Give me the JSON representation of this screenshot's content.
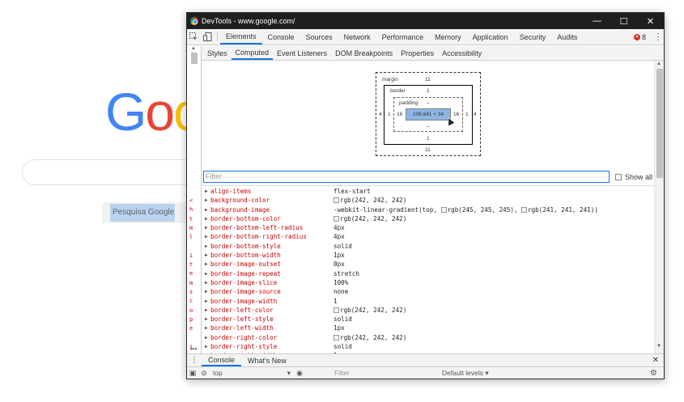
{
  "google": {
    "logo_letters": [
      {
        "char": "G",
        "color": "#4285f4"
      },
      {
        "char": "o",
        "color": "#ea4335"
      },
      {
        "char": "o",
        "color": "#fbbc05"
      }
    ],
    "search_button_label": "Pesquisa Google"
  },
  "devtools": {
    "window_title": "DevTools - www.google.com/",
    "window_buttons": {
      "minimize": "—",
      "maximize": "☐",
      "close": "✕"
    },
    "main_tabs": [
      {
        "label": "Elements",
        "active": true
      },
      {
        "label": "Console",
        "active": false
      },
      {
        "label": "Sources",
        "active": false
      },
      {
        "label": "Network",
        "active": false
      },
      {
        "label": "Performance",
        "active": false
      },
      {
        "label": "Memory",
        "active": false
      },
      {
        "label": "Application",
        "active": false
      },
      {
        "label": "Security",
        "active": false
      },
      {
        "label": "Audits",
        "active": false
      }
    ],
    "error_count": "8",
    "sub_tabs": [
      {
        "label": "Styles",
        "active": false
      },
      {
        "label": "Computed",
        "active": true
      },
      {
        "label": "Event Listeners",
        "active": false
      },
      {
        "label": "DOM Breakpoints",
        "active": false
      },
      {
        "label": "Properties",
        "active": false
      },
      {
        "label": "Accessibility",
        "active": false
      }
    ],
    "box_model": {
      "margin_label": "margin",
      "margin_top": "11",
      "margin_bottom": "11",
      "margin_left": "4",
      "margin_right": "4",
      "border_label": "border",
      "border_top": "1",
      "border_bottom": "1",
      "border_left": "1",
      "border_right": "1",
      "padding_label": "padding",
      "padding_top": "–",
      "padding_bottom": "–",
      "padding_left": "16",
      "padding_right": "16",
      "content_size": "106.641 × 34"
    },
    "filter_placeholder": "Filter",
    "show_all_label": "Show all",
    "left_gutter_chars": [
      "<",
      "h",
      "t",
      "m",
      "l",
      "",
      "i",
      "t",
      "e",
      "m",
      "s",
      "c",
      "o",
      "p",
      "e",
      "",
      "i"
    ],
    "properties": [
      {
        "name": "align-items",
        "value": "flex-start"
      },
      {
        "name": "background-color",
        "value": "rgb(242, 242, 242)",
        "swatch": "#f2f2f2"
      },
      {
        "name": "background-image",
        "value_parts": [
          "-webkit-linear-gradient(top, ",
          "rgb(245, 245, 245), ",
          "rgb(241, 241, 241))"
        ],
        "swatches": [
          "#f5f5f5",
          "#f1f1f1"
        ]
      },
      {
        "name": "border-bottom-color",
        "value": "rgb(242, 242, 242)",
        "swatch": "#f2f2f2"
      },
      {
        "name": "border-bottom-left-radius",
        "value": "4px"
      },
      {
        "name": "border-bottom-right-radius",
        "value": "4px"
      },
      {
        "name": "border-bottom-style",
        "value": "solid"
      },
      {
        "name": "border-bottom-width",
        "value": "1px"
      },
      {
        "name": "border-image-outset",
        "value": "0px"
      },
      {
        "name": "border-image-repeat",
        "value": "stretch"
      },
      {
        "name": "border-image-slice",
        "value": "100%"
      },
      {
        "name": "border-image-source",
        "value": "none"
      },
      {
        "name": "border-image-width",
        "value": "1"
      },
      {
        "name": "border-left-color",
        "value": "rgb(242, 242, 242)",
        "swatch": "#f2f2f2"
      },
      {
        "name": "border-left-style",
        "value": "solid"
      },
      {
        "name": "border-left-width",
        "value": "1px"
      },
      {
        "name": "border-right-color",
        "value": "rgb(242, 242, 242)",
        "swatch": "#f2f2f2"
      },
      {
        "name": "border-right-style",
        "value": "solid"
      },
      {
        "name": "border-right-width",
        "value": "1px"
      }
    ],
    "drawer": {
      "tabs": [
        {
          "label": "Console",
          "active": true
        },
        {
          "label": "What's New",
          "active": false
        }
      ],
      "context": "top",
      "filter_placeholder": "Filter",
      "levels_label": "Default levels ▾"
    }
  }
}
